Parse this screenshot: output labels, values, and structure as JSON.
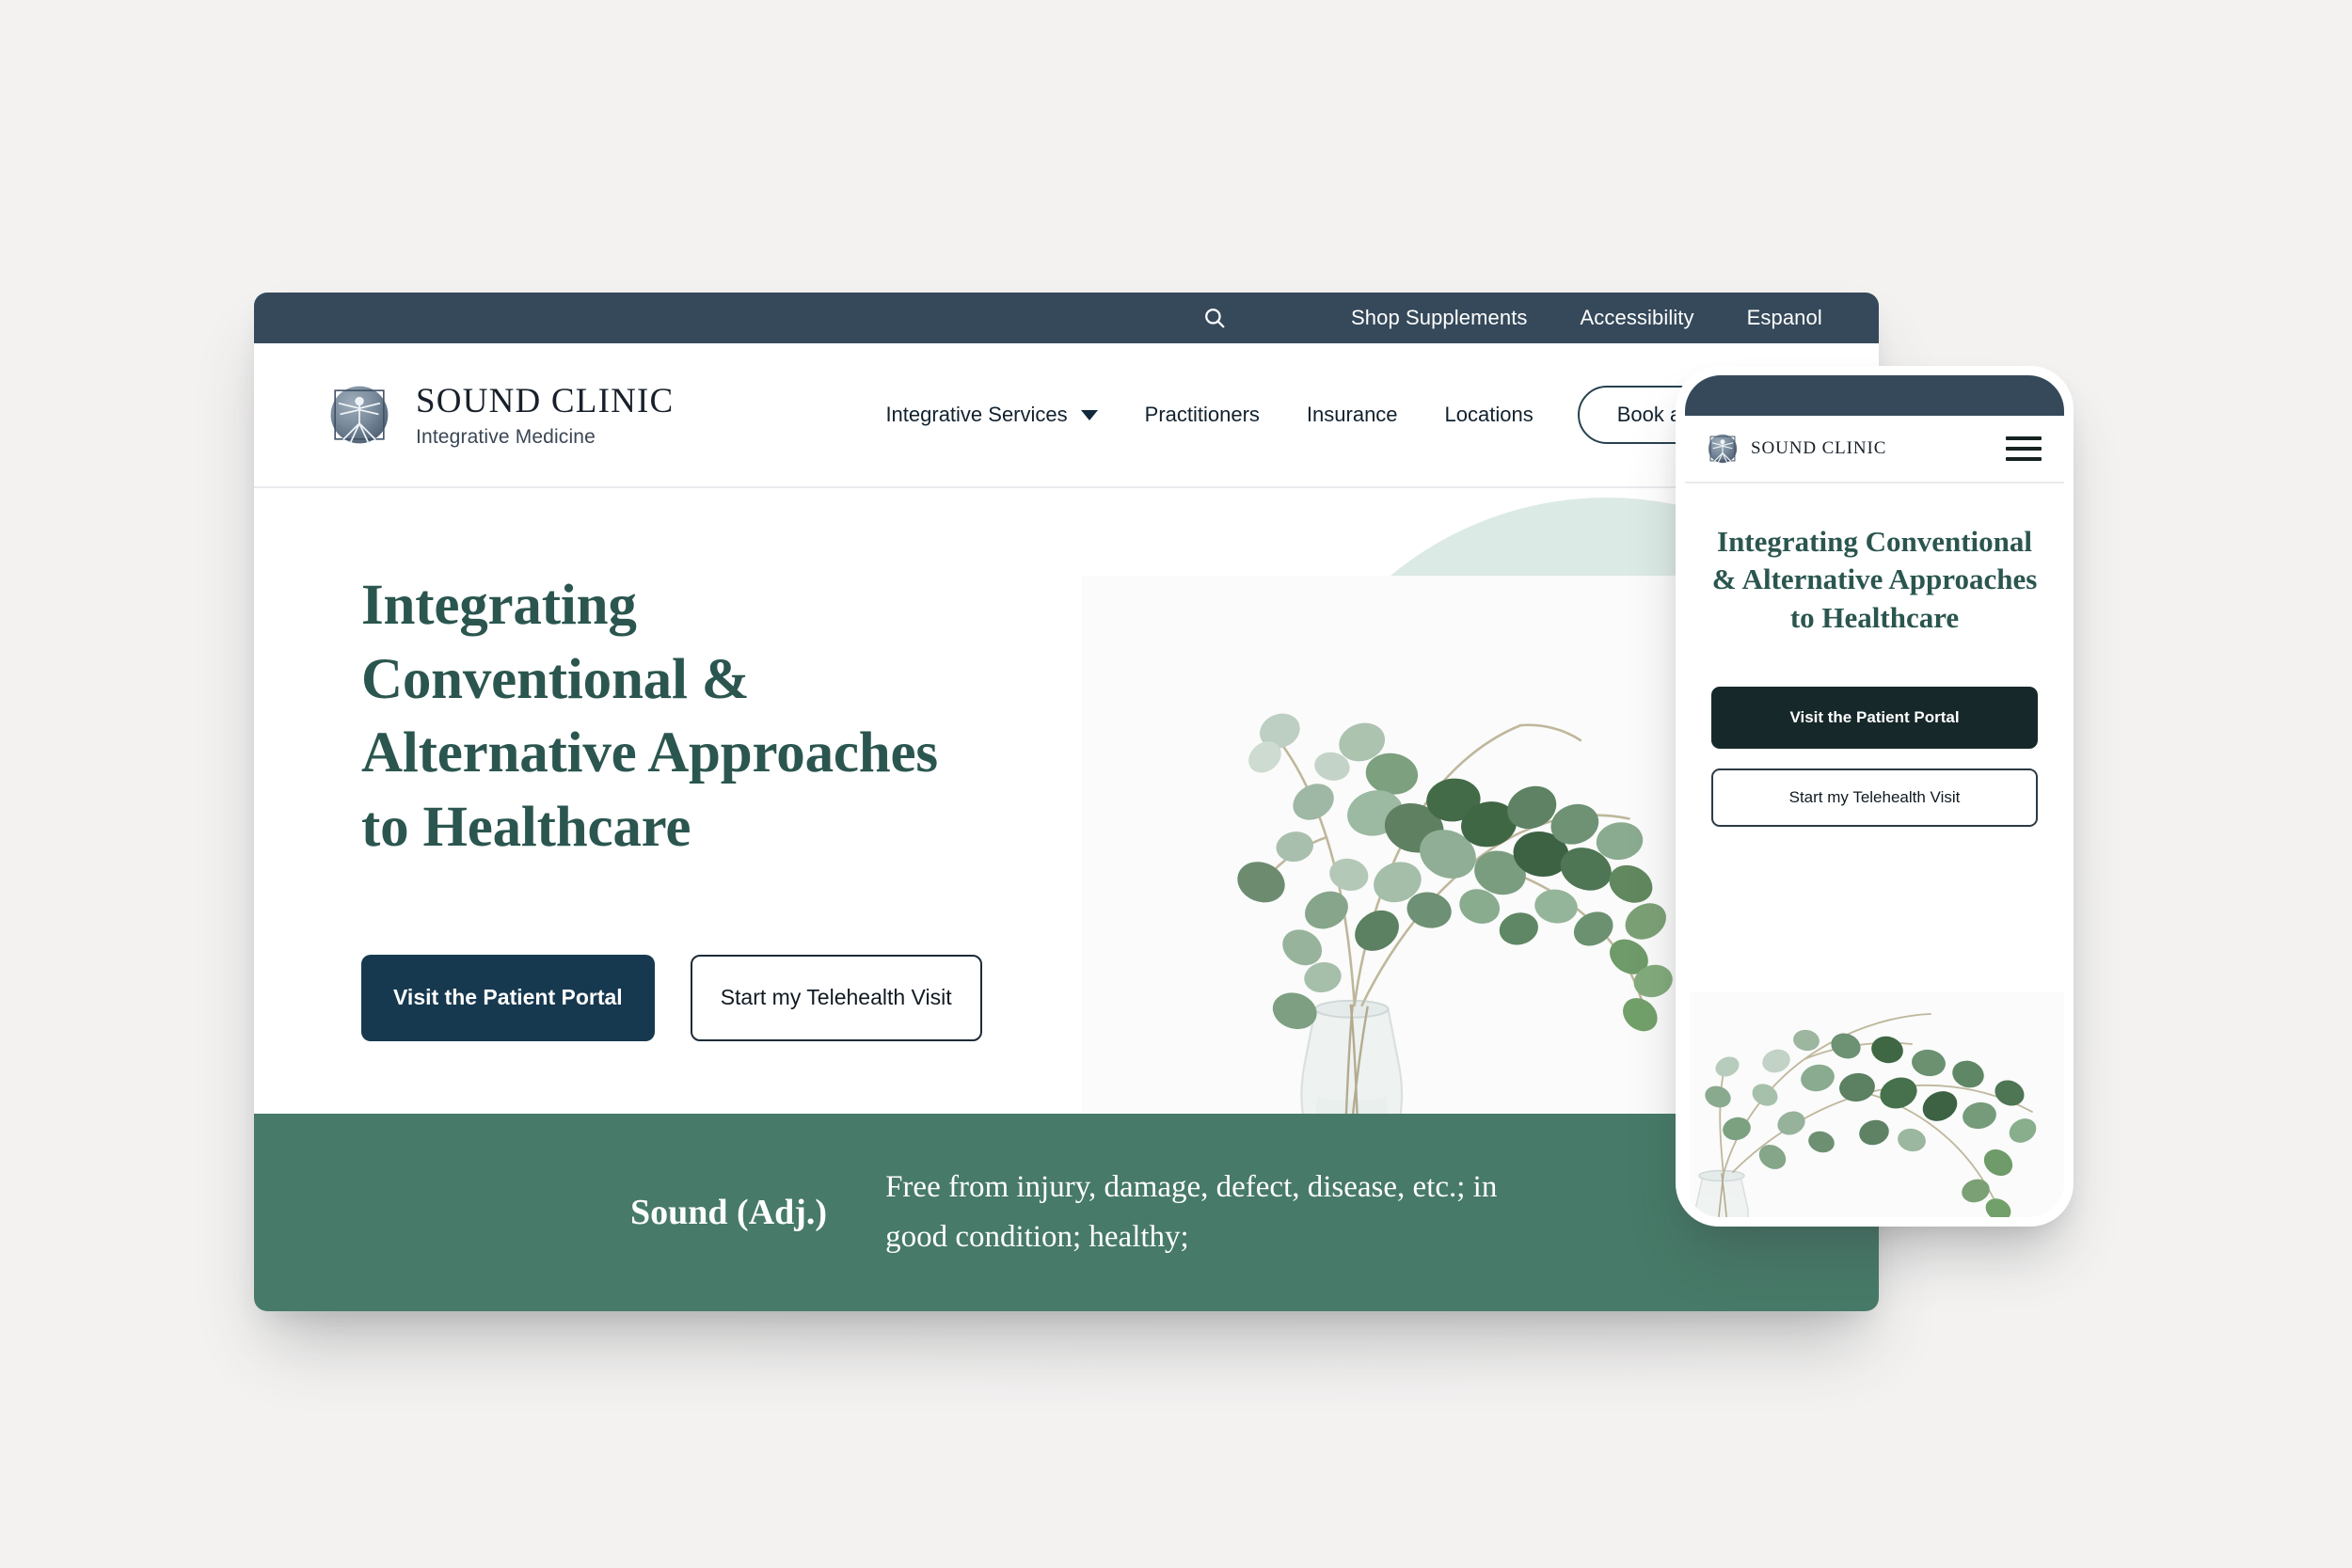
{
  "brand": {
    "name": "SOUND CLINIC",
    "tagline": "Integrative Medicine",
    "logo_icon": "vitruvian-man-icon"
  },
  "colors": {
    "topbar_navy": "#35495a",
    "heading_teal": "#2b564f",
    "banner_green": "#477a68",
    "primary_button_navy": "#16394f",
    "mobile_primary_button": "#17282a",
    "mint_circle": "#dceae6",
    "page_background": "#f3f2f1"
  },
  "desktop": {
    "topbar": {
      "search_icon": "search-icon",
      "links": [
        {
          "label": "Shop Supplements"
        },
        {
          "label": "Accessibility"
        },
        {
          "label": "Espanol"
        }
      ]
    },
    "nav": {
      "items": [
        {
          "label": "Integrative Services",
          "has_dropdown": true
        },
        {
          "label": "Practitioners",
          "has_dropdown": false
        },
        {
          "label": "Insurance",
          "has_dropdown": false
        },
        {
          "label": "Locations",
          "has_dropdown": false
        }
      ],
      "cta_label": "Book an Appo"
    },
    "hero": {
      "title": "Integrating Conventional & Alternative Approaches to Healthcare",
      "primary_button": "Visit the Patient Portal",
      "secondary_button": "Start my Telehealth Visit",
      "image_alt": "eucalyptus-branches-in-glass-vase"
    },
    "definition_band": {
      "word": "Sound (Adj.)",
      "definition": "Free from injury, damage, defect, disease, etc.; in good condition; healthy;"
    }
  },
  "phone": {
    "brand_name": "SOUND CLINIC",
    "menu_icon": "hamburger-menu-icon",
    "hero": {
      "title": "Integrating Conventional & Alternative Approaches to Healthcare",
      "primary_button": "Visit the Patient Portal",
      "secondary_button": "Start my Telehealth Visit",
      "image_alt": "eucalyptus-branches-in-glass-vase"
    }
  }
}
